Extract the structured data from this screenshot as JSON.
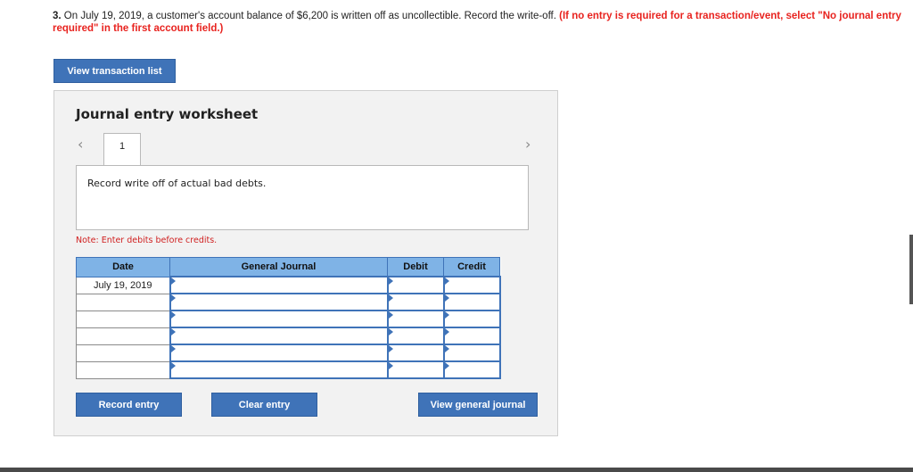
{
  "question": {
    "number": "3.",
    "text": " On July 19, 2019, a customer's account balance of $6,200 is written off as uncollectible. Record the write-off. ",
    "instruction": "(If no entry is required for a transaction/event, select \"No journal entry required\" in the first account field.)"
  },
  "buttons": {
    "view_transaction_list": "View transaction list",
    "record_entry": "Record entry",
    "clear_entry": "Clear entry",
    "view_general_journal": "View general journal"
  },
  "worksheet": {
    "title": "Journal entry worksheet",
    "prev_icon": "chevron-left-icon",
    "next_icon": "chevron-right-icon",
    "current_tab": "1",
    "description": "Record write off of actual bad debts.",
    "note": "Note: Enter debits before credits."
  },
  "journal": {
    "headers": {
      "date": "Date",
      "account": "General Journal",
      "debit": "Debit",
      "credit": "Credit"
    },
    "rows": [
      {
        "date": "July 19, 2019",
        "account": "",
        "debit": "",
        "credit": ""
      },
      {
        "date": "",
        "account": "",
        "debit": "",
        "credit": ""
      },
      {
        "date": "",
        "account": "",
        "debit": "",
        "credit": ""
      },
      {
        "date": "",
        "account": "",
        "debit": "",
        "credit": ""
      },
      {
        "date": "",
        "account": "",
        "debit": "",
        "credit": ""
      },
      {
        "date": "",
        "account": "",
        "debit": "",
        "credit": ""
      }
    ]
  },
  "colors": {
    "accent": "#3f73b8",
    "header_bg": "#7fb3e6",
    "instruction": "#e8231f",
    "note": "#d01f1f"
  }
}
